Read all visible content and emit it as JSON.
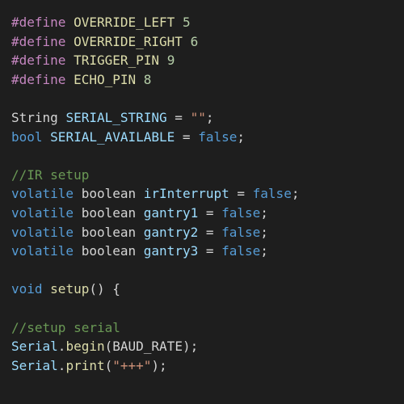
{
  "editor": {
    "background": "#1e1e1e",
    "lines": [
      [
        {
          "t": "#define",
          "k": "macro"
        },
        {
          "t": " ",
          "k": "plain"
        },
        {
          "t": "OVERRIDE_LEFT",
          "k": "fn"
        },
        {
          "t": " ",
          "k": "plain"
        },
        {
          "t": "5",
          "k": "num"
        }
      ],
      [
        {
          "t": "#define",
          "k": "macro"
        },
        {
          "t": " ",
          "k": "plain"
        },
        {
          "t": "OVERRIDE_RIGHT",
          "k": "fn"
        },
        {
          "t": " ",
          "k": "plain"
        },
        {
          "t": "6",
          "k": "num"
        }
      ],
      [
        {
          "t": "#define",
          "k": "macro"
        },
        {
          "t": " ",
          "k": "plain"
        },
        {
          "t": "TRIGGER_PIN",
          "k": "fn"
        },
        {
          "t": " ",
          "k": "plain"
        },
        {
          "t": "9",
          "k": "num"
        }
      ],
      [
        {
          "t": "#define",
          "k": "macro"
        },
        {
          "t": " ",
          "k": "plain"
        },
        {
          "t": "ECHO_PIN",
          "k": "fn"
        },
        {
          "t": " ",
          "k": "plain"
        },
        {
          "t": "8",
          "k": "num"
        }
      ],
      [],
      [
        {
          "t": "String",
          "k": "plain"
        },
        {
          "t": " ",
          "k": "plain"
        },
        {
          "t": "SERIAL_STRING",
          "k": "var"
        },
        {
          "t": " = ",
          "k": "plain"
        },
        {
          "t": "\"\"",
          "k": "str"
        },
        {
          "t": ";",
          "k": "plain"
        }
      ],
      [
        {
          "t": "bool",
          "k": "kw"
        },
        {
          "t": " ",
          "k": "plain"
        },
        {
          "t": "SERIAL_AVAILABLE",
          "k": "var"
        },
        {
          "t": " = ",
          "k": "plain"
        },
        {
          "t": "false",
          "k": "kw"
        },
        {
          "t": ";",
          "k": "plain"
        }
      ],
      [],
      [
        {
          "t": "//IR setup",
          "k": "comment"
        }
      ],
      [
        {
          "t": "volatile",
          "k": "kw"
        },
        {
          "t": " ",
          "k": "plain"
        },
        {
          "t": "boolean",
          "k": "plain"
        },
        {
          "t": " ",
          "k": "plain"
        },
        {
          "t": "irInterrupt",
          "k": "var"
        },
        {
          "t": " = ",
          "k": "plain"
        },
        {
          "t": "false",
          "k": "kw"
        },
        {
          "t": ";",
          "k": "plain"
        }
      ],
      [
        {
          "t": "volatile",
          "k": "kw"
        },
        {
          "t": " ",
          "k": "plain"
        },
        {
          "t": "boolean",
          "k": "plain"
        },
        {
          "t": " ",
          "k": "plain"
        },
        {
          "t": "gantry1",
          "k": "var"
        },
        {
          "t": " = ",
          "k": "plain"
        },
        {
          "t": "false",
          "k": "kw"
        },
        {
          "t": ";",
          "k": "plain"
        }
      ],
      [
        {
          "t": "volatile",
          "k": "kw"
        },
        {
          "t": " ",
          "k": "plain"
        },
        {
          "t": "boolean",
          "k": "plain"
        },
        {
          "t": " ",
          "k": "plain"
        },
        {
          "t": "gantry2",
          "k": "var"
        },
        {
          "t": " = ",
          "k": "plain"
        },
        {
          "t": "false",
          "k": "kw"
        },
        {
          "t": ";",
          "k": "plain"
        }
      ],
      [
        {
          "t": "volatile",
          "k": "kw"
        },
        {
          "t": " ",
          "k": "plain"
        },
        {
          "t": "boolean",
          "k": "plain"
        },
        {
          "t": " ",
          "k": "plain"
        },
        {
          "t": "gantry3",
          "k": "var"
        },
        {
          "t": " = ",
          "k": "plain"
        },
        {
          "t": "false",
          "k": "kw"
        },
        {
          "t": ";",
          "k": "plain"
        }
      ],
      [],
      [
        {
          "t": "void",
          "k": "kw"
        },
        {
          "t": " ",
          "k": "plain"
        },
        {
          "t": "setup",
          "k": "fn"
        },
        {
          "t": "() {",
          "k": "plain"
        }
      ],
      [],
      [
        {
          "t": "//setup serial",
          "k": "comment"
        }
      ],
      [
        {
          "t": "Serial",
          "k": "var"
        },
        {
          "t": ".",
          "k": "plain"
        },
        {
          "t": "begin",
          "k": "fn"
        },
        {
          "t": "(",
          "k": "plain"
        },
        {
          "t": "BAUD_RATE",
          "k": "plain"
        },
        {
          "t": ");",
          "k": "plain"
        }
      ],
      [
        {
          "t": "Serial",
          "k": "var"
        },
        {
          "t": ".",
          "k": "plain"
        },
        {
          "t": "print",
          "k": "fn"
        },
        {
          "t": "(",
          "k": "plain"
        },
        {
          "t": "\"+++\"",
          "k": "str"
        },
        {
          "t": ");",
          "k": "plain"
        }
      ]
    ]
  }
}
